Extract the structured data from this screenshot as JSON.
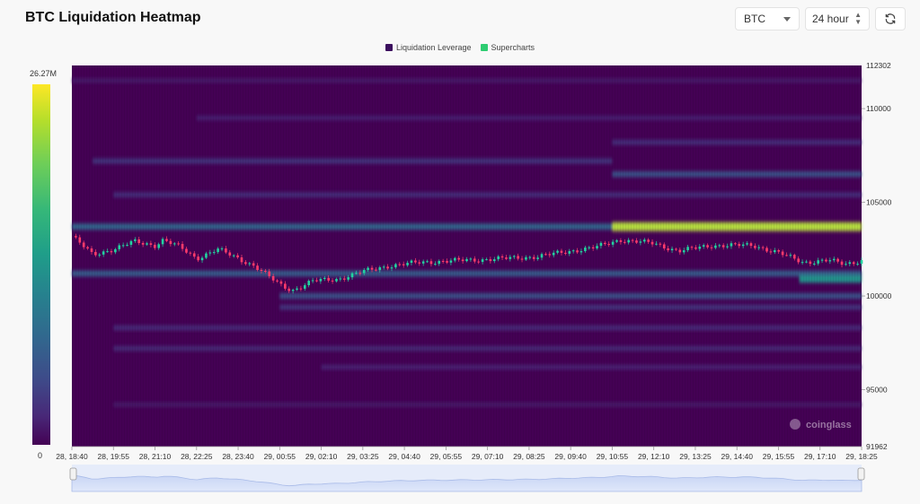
{
  "header": {
    "title": "BTC Liquidation Heatmap",
    "coin_select": "BTC",
    "range_select": "24 hour"
  },
  "legend": {
    "items": [
      {
        "label": "Liquidation Leverage",
        "color": "#3b0f5e"
      },
      {
        "label": "Supercharts",
        "color": "#2ecc71"
      }
    ]
  },
  "colorbar": {
    "max_label": "26.27M",
    "min_label": "0"
  },
  "watermark": "coinglass",
  "chart_data": {
    "type": "heatmap",
    "x_ticks": [
      "28, 18:40",
      "28, 19:55",
      "28, 21:10",
      "28, 22:25",
      "28, 23:40",
      "29, 00:55",
      "29, 02:10",
      "29, 03:25",
      "29, 04:40",
      "29, 05:55",
      "29, 07:10",
      "29, 08:25",
      "29, 09:40",
      "29, 10:55",
      "29, 12:10",
      "29, 13:25",
      "29, 14:40",
      "29, 15:55",
      "29, 17:10",
      "29, 18:25"
    ],
    "y_ticks": [
      110000,
      105000,
      100000,
      95000
    ],
    "ylim": [
      91962,
      112302
    ],
    "ymax_label": "112302",
    "ymin_label": "91962",
    "bands": [
      {
        "price": 103700,
        "start": 0,
        "end": 19,
        "intensity": 0.45
      },
      {
        "price": 103700,
        "start": 13,
        "end": 19,
        "intensity": 0.95
      },
      {
        "price": 101200,
        "start": 0,
        "end": 19,
        "intensity": 0.4
      },
      {
        "price": 100900,
        "start": 17.5,
        "end": 19,
        "intensity": 0.65
      },
      {
        "price": 100000,
        "start": 5,
        "end": 19,
        "intensity": 0.35
      },
      {
        "price": 106500,
        "start": 13,
        "end": 19,
        "intensity": 0.35
      },
      {
        "price": 107200,
        "start": 0.5,
        "end": 13,
        "intensity": 0.22
      },
      {
        "price": 105400,
        "start": 1,
        "end": 19,
        "intensity": 0.2
      },
      {
        "price": 99400,
        "start": 5,
        "end": 19,
        "intensity": 0.22
      },
      {
        "price": 98300,
        "start": 1,
        "end": 19,
        "intensity": 0.18
      },
      {
        "price": 97200,
        "start": 1,
        "end": 19,
        "intensity": 0.17
      },
      {
        "price": 96200,
        "start": 6,
        "end": 19,
        "intensity": 0.14
      },
      {
        "price": 108200,
        "start": 13,
        "end": 19,
        "intensity": 0.2
      },
      {
        "price": 109500,
        "start": 3,
        "end": 19,
        "intensity": 0.13
      },
      {
        "price": 94200,
        "start": 1,
        "end": 19,
        "intensity": 0.1
      },
      {
        "price": 111500,
        "start": 0,
        "end": 19,
        "intensity": 0.1
      }
    ],
    "price_series": [
      {
        "x": 0,
        "price": 103200
      },
      {
        "x": 0.5,
        "price": 102200
      },
      {
        "x": 1,
        "price": 102500
      },
      {
        "x": 1.5,
        "price": 102900
      },
      {
        "x": 2,
        "price": 102700
      },
      {
        "x": 2.2,
        "price": 103000
      },
      {
        "x": 2.6,
        "price": 102600
      },
      {
        "x": 3,
        "price": 102000
      },
      {
        "x": 3.5,
        "price": 102500
      },
      {
        "x": 4,
        "price": 102000
      },
      {
        "x": 4.4,
        "price": 101600
      },
      {
        "x": 5,
        "price": 100600
      },
      {
        "x": 5.3,
        "price": 100300
      },
      {
        "x": 5.8,
        "price": 100800
      },
      {
        "x": 6.4,
        "price": 100900
      },
      {
        "x": 7,
        "price": 101300
      },
      {
        "x": 7.6,
        "price": 101600
      },
      {
        "x": 8.4,
        "price": 101800
      },
      {
        "x": 9.4,
        "price": 101900
      },
      {
        "x": 10.4,
        "price": 102000
      },
      {
        "x": 11.2,
        "price": 102100
      },
      {
        "x": 12,
        "price": 102400
      },
      {
        "x": 12.6,
        "price": 102600
      },
      {
        "x": 13.2,
        "price": 103000
      },
      {
        "x": 14,
        "price": 102800
      },
      {
        "x": 14.6,
        "price": 102400
      },
      {
        "x": 15.4,
        "price": 102700
      },
      {
        "x": 16.4,
        "price": 102700
      },
      {
        "x": 17,
        "price": 102300
      },
      {
        "x": 17.6,
        "price": 101800
      },
      {
        "x": 18.2,
        "price": 101900
      },
      {
        "x": 18.6,
        "price": 101700
      },
      {
        "x": 19,
        "price": 101900
      }
    ],
    "grid": false,
    "legend_position": "top-center"
  }
}
